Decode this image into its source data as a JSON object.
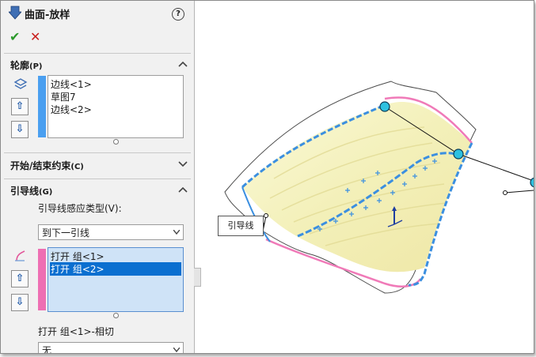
{
  "panel": {
    "title": "曲面-放样",
    "help_label": "?",
    "ok_label": "✔",
    "cancel_label": "✕"
  },
  "profiles": {
    "title": "轮廓",
    "shortcut": "(P)",
    "items": [
      "边线<1>",
      "草图7",
      "边线<2>"
    ],
    "up_label": "⇧",
    "down_label": "⇩"
  },
  "start_end": {
    "title": "开始/结束约束",
    "shortcut": "(C)"
  },
  "guides": {
    "title": "引导线",
    "shortcut": "(G)",
    "influence_label": "引导线感应类型(V):",
    "influence_value": "到下一引线",
    "items": [
      "打开 组<1>",
      "打开 组<2>"
    ],
    "selected_index": 1,
    "up_label": "⇧",
    "down_label": "⇩",
    "tangency_label": "打开 组<1>-相切",
    "tangency_value": "无"
  },
  "viewport": {
    "callout_label": "引导线"
  },
  "colors": {
    "profile_bar": "#4a9ff0",
    "guide_bar": "#ee6fb3",
    "selection": "#0a6fd0",
    "surface": "#f7f5c8",
    "edge_blue": "#3b8fe0",
    "edge_pink": "#f07ab8"
  }
}
